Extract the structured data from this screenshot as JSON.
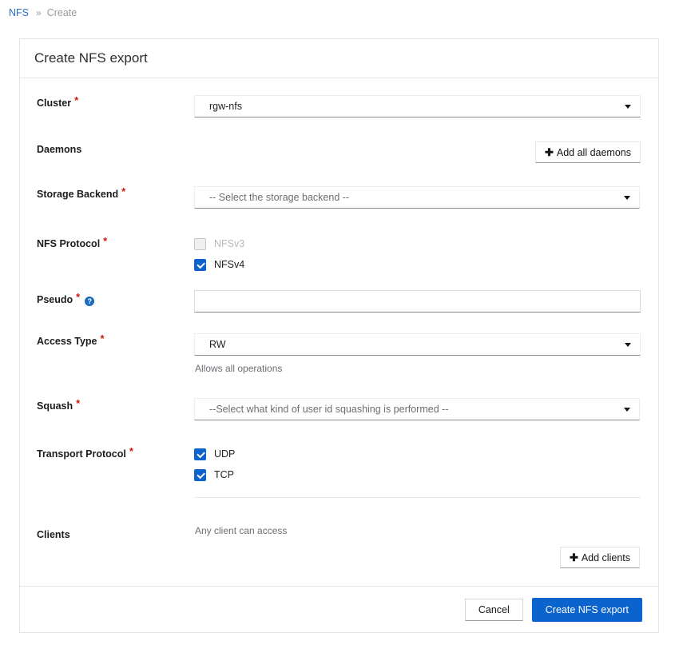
{
  "breadcrumb": {
    "root": "NFS",
    "separator": "»",
    "current": "Create"
  },
  "card": {
    "title": "Create NFS export"
  },
  "form": {
    "cluster": {
      "label": "Cluster",
      "required_marker": "*",
      "value": "rgw-nfs"
    },
    "daemons": {
      "label": "Daemons",
      "add_button": "Add all daemons",
      "plus": "✚"
    },
    "storage_backend": {
      "label": "Storage Backend",
      "required_marker": "*",
      "value": "-- Select the storage backend --"
    },
    "nfs_protocol": {
      "label": "NFS Protocol",
      "required_marker": "*",
      "options": [
        {
          "label": "NFSv3",
          "checked": false,
          "disabled": true
        },
        {
          "label": "NFSv4",
          "checked": true,
          "disabled": false
        }
      ]
    },
    "pseudo": {
      "label": "Pseudo",
      "required_marker": "*",
      "help_icon": "?",
      "value": "",
      "placeholder": ""
    },
    "access_type": {
      "label": "Access Type",
      "required_marker": "*",
      "value": "RW",
      "helper_text": "Allows all operations"
    },
    "squash": {
      "label": "Squash",
      "required_marker": "*",
      "value": "--Select what kind of user id squashing is performed --"
    },
    "transport_protocol": {
      "label": "Transport Protocol",
      "required_marker": "*",
      "options": [
        {
          "label": "UDP",
          "checked": true,
          "disabled": false
        },
        {
          "label": "TCP",
          "checked": true,
          "disabled": false
        }
      ]
    },
    "clients": {
      "label": "Clients",
      "status_text": "Any client can access",
      "add_button": "Add clients",
      "plus": "✚"
    }
  },
  "footer": {
    "cancel_label": "Cancel",
    "submit_label": "Create NFS export"
  },
  "colors": {
    "primary": "#0b63ce",
    "link": "#2b6ec8",
    "required": "#c9190b",
    "muted": "#6a6e73"
  }
}
